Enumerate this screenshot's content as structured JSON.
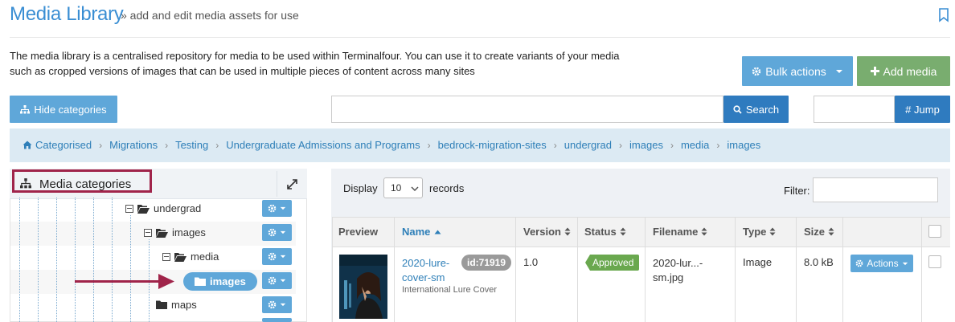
{
  "header": {
    "title": "Media Library",
    "subtitle": "» add and edit media assets for use"
  },
  "intro": {
    "line1": "The media library is a centralised repository for media to be used within Terminalfour. You can use it to create variants of your media",
    "line2": "such as cropped versions of images that can be used in multiple pieces of content across many sites"
  },
  "toolbar": {
    "bulk_actions_label": "Bulk actions",
    "add_media_label": "Add media",
    "hide_categories_label": "Hide categories",
    "search_value": "",
    "search_label": "Search",
    "jump_value": "",
    "jump_label": "# Jump"
  },
  "breadcrumb": [
    "Categorised",
    "Migrations",
    "Testing",
    "Undergraduate Admissions and Programs",
    "bedrock-migration-sites",
    "undergrad",
    "images",
    "media",
    "images"
  ],
  "categories": {
    "title": "Media categories",
    "items": [
      {
        "label": "undergrad",
        "expanded": true
      },
      {
        "label": "images",
        "expanded": true
      },
      {
        "label": "media",
        "expanded": true
      },
      {
        "label": "images",
        "active": true
      },
      {
        "label": "maps"
      }
    ]
  },
  "table": {
    "display_label": "Display",
    "display_value": "10",
    "records_label": "records",
    "filter_label": "Filter:",
    "filter_value": "",
    "columns": [
      "Preview",
      "Name",
      "Version",
      "Status",
      "Filename",
      "Type",
      "Size"
    ],
    "rows": [
      {
        "name_line1": "2020-lure-",
        "name_line2": "cover-sm",
        "id_badge": "id:71919",
        "description": "International Lure Cover",
        "version": "1.0",
        "status": "Approved",
        "filename_line1": "2020-lur...-",
        "filename_line2": "sm.jpg",
        "type": "Image",
        "size": "8.0 kB",
        "actions_label": "Actions"
      }
    ]
  },
  "colors": {
    "accent": "#3a8ed3",
    "button_blue": "#5fa7d9",
    "button_dark_blue": "#2f7bbf",
    "button_green": "#79ad6f",
    "status_approved": "#6aa84f",
    "highlight": "#a0244a"
  },
  "icons": [
    "bookmark-icon",
    "gear-icon",
    "sitemap-icon",
    "search-icon",
    "home-icon",
    "expand-icon",
    "folder-icon",
    "plus-icon",
    "minus-icon",
    "arrow-icon"
  ]
}
